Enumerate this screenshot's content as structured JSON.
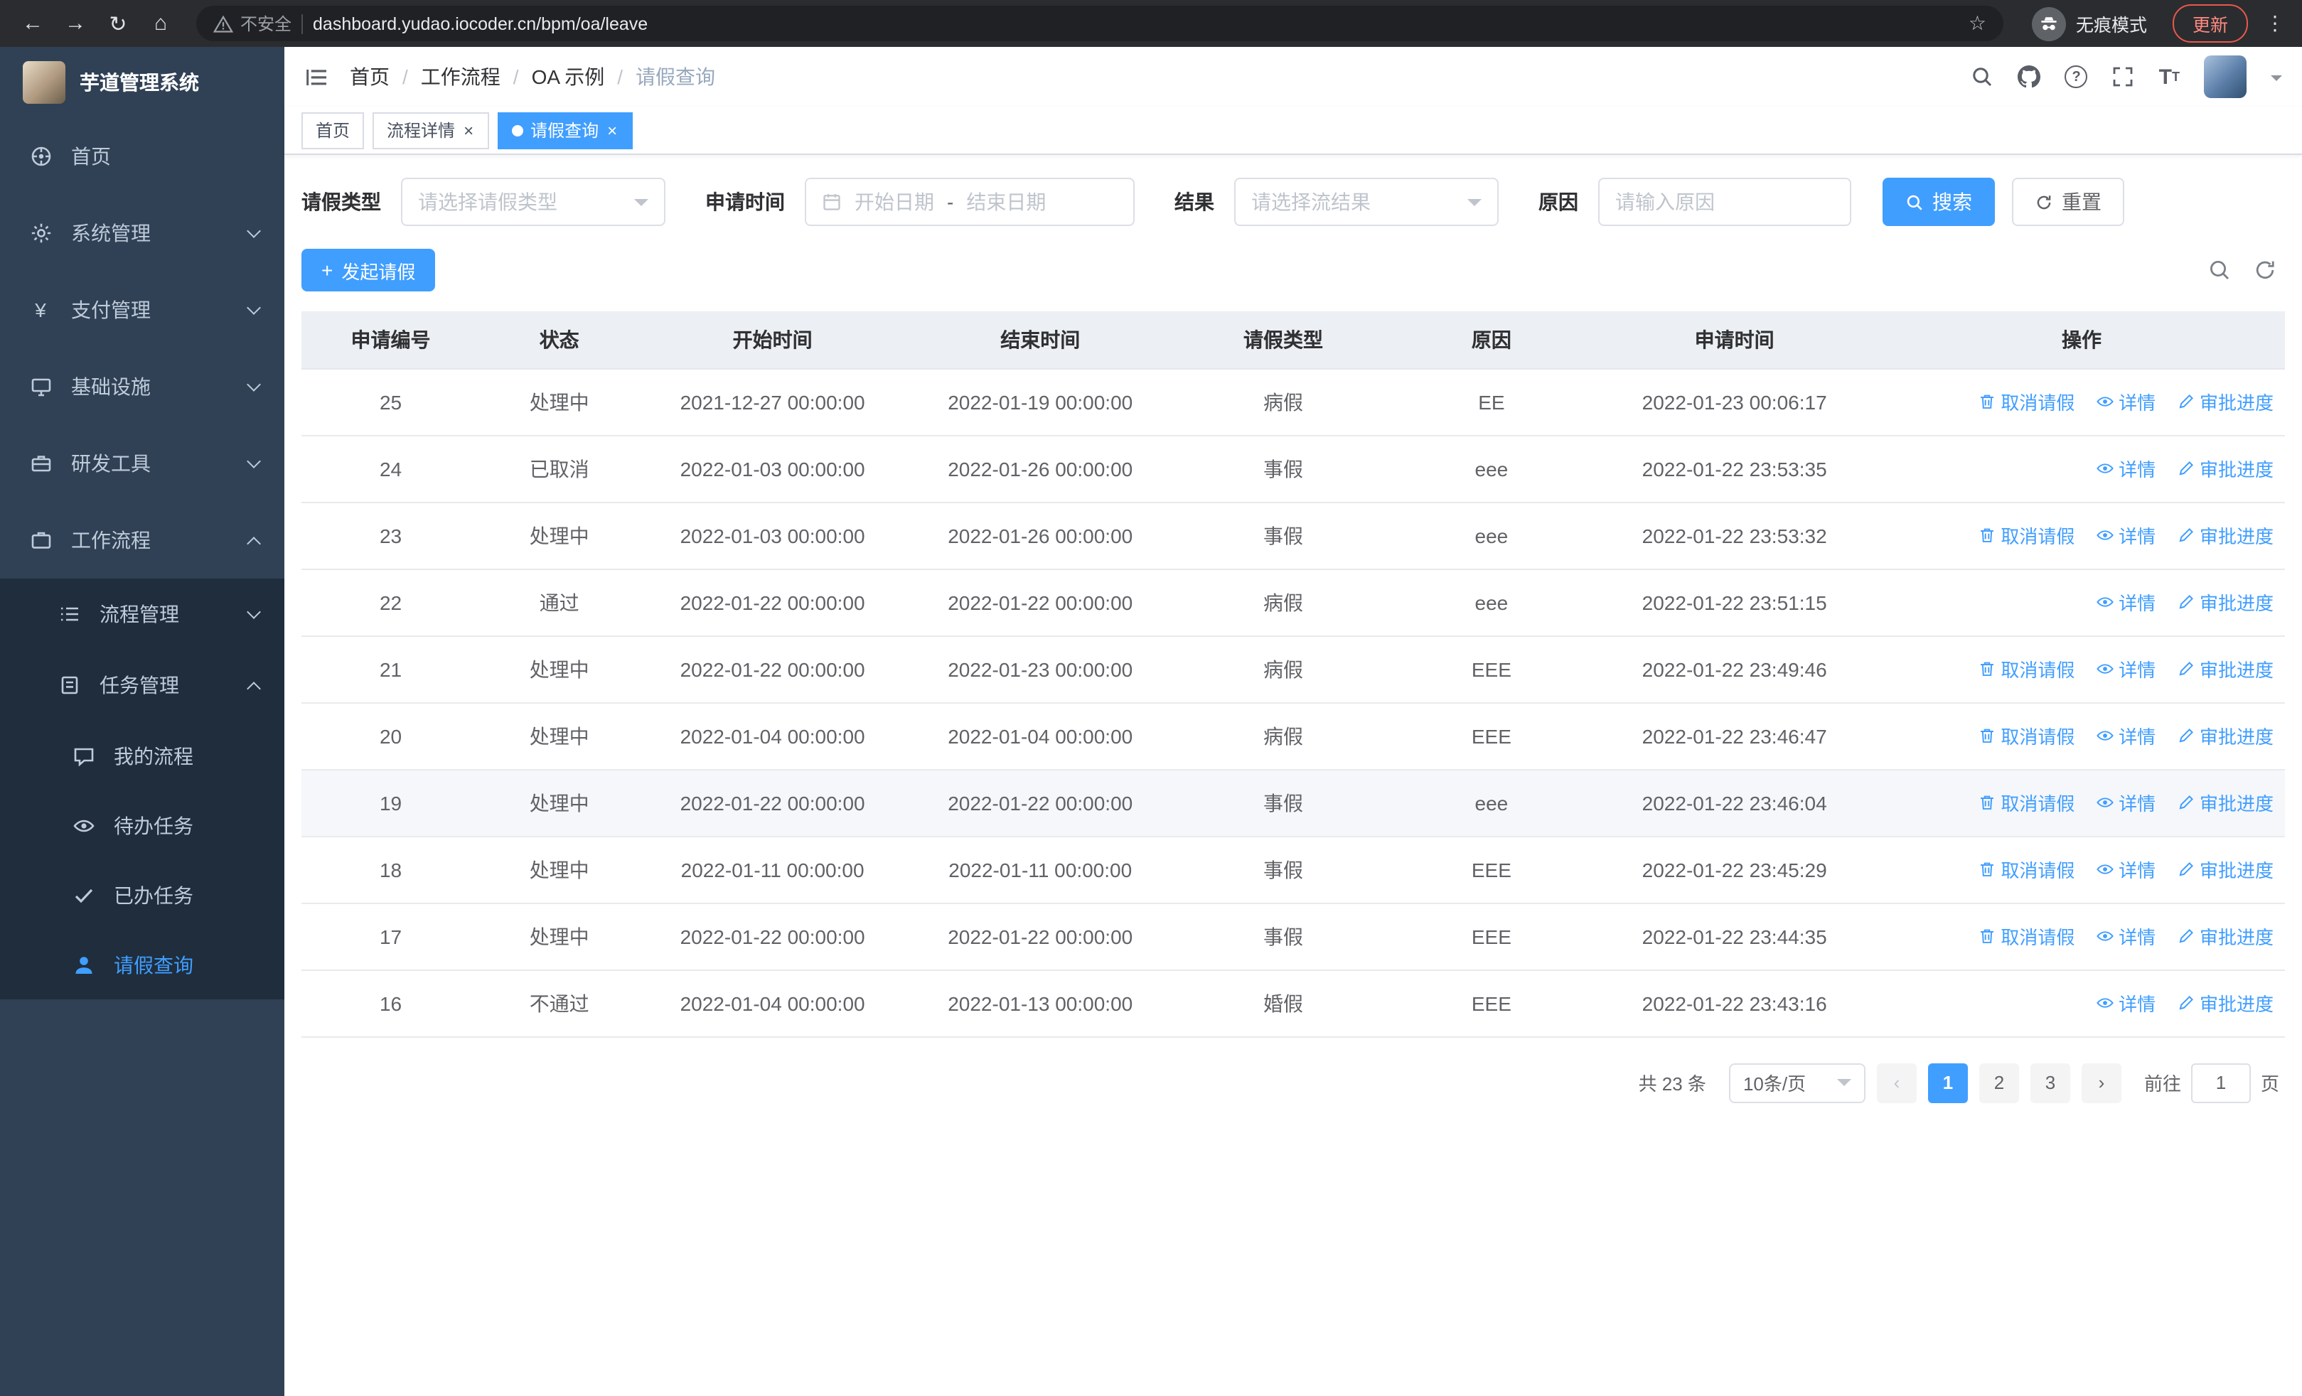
{
  "browser": {
    "back_icon": "←",
    "forward_icon": "→",
    "reload_icon": "↻",
    "home_icon": "⌂",
    "security_label": "不安全",
    "url": "dashboard.yudao.iocoder.cn/bpm/oa/leave",
    "star_icon": "☆",
    "incognito_label": "无痕模式",
    "update_label": "更新",
    "kebab_icon": "⋮"
  },
  "app_title": "芋道管理系统",
  "sidebar": {
    "yen_icon": "¥",
    "menu": [
      {
        "label": "首页"
      },
      {
        "label": "系统管理"
      },
      {
        "label": "支付管理"
      },
      {
        "label": "基础设施"
      },
      {
        "label": "研发工具"
      },
      {
        "label": "工作流程"
      }
    ],
    "submenu": [
      {
        "label": "流程管理"
      },
      {
        "label": "任务管理"
      }
    ],
    "leaves": [
      {
        "label": "我的流程"
      },
      {
        "label": "待办任务"
      },
      {
        "label": "已办任务"
      },
      {
        "label": "请假查询"
      }
    ]
  },
  "breadcrumb": {
    "separator": "/",
    "items": [
      "首页",
      "工作流程",
      "OA 示例",
      "请假查询"
    ]
  },
  "tabs": {
    "close_icon": "×",
    "items": [
      {
        "label": "首页"
      },
      {
        "label": "流程详情"
      },
      {
        "label": "请假查询"
      }
    ]
  },
  "filter": {
    "leave_type_label": "请假类型",
    "leave_type_placeholder": "请选择请假类型",
    "apply_time_label": "申请时间",
    "date_start_placeholder": "开始日期",
    "date_separator": "-",
    "date_end_placeholder": "结束日期",
    "result_label": "结果",
    "result_placeholder": "请选择流结果",
    "reason_label": "原因",
    "reason_placeholder": "请输入原因",
    "search_label": "搜索",
    "reset_label": "重置"
  },
  "toolbar": {
    "plus_icon": "+",
    "create_label": "发起请假"
  },
  "table": {
    "headers": [
      "申请编号",
      "状态",
      "开始时间",
      "结束时间",
      "请假类型",
      "原因",
      "申请时间",
      "操作"
    ],
    "op_labels": {
      "cancel": "取消请假",
      "detail": "详情",
      "progress": "审批进度"
    },
    "rows": [
      {
        "id": "25",
        "status": "处理中",
        "start": "2021-12-27 00:00:00",
        "end": "2022-01-19 00:00:00",
        "type": "病假",
        "reason": "EE",
        "apply_time": "2022-01-23 00:06:17",
        "ops": [
          "cancel",
          "detail",
          "progress"
        ]
      },
      {
        "id": "24",
        "status": "已取消",
        "start": "2022-01-03 00:00:00",
        "end": "2022-01-26 00:00:00",
        "type": "事假",
        "reason": "eee",
        "apply_time": "2022-01-22 23:53:35",
        "ops": [
          "detail",
          "progress"
        ]
      },
      {
        "id": "23",
        "status": "处理中",
        "start": "2022-01-03 00:00:00",
        "end": "2022-01-26 00:00:00",
        "type": "事假",
        "reason": "eee",
        "apply_time": "2022-01-22 23:53:32",
        "ops": [
          "cancel",
          "detail",
          "progress"
        ]
      },
      {
        "id": "22",
        "status": "通过",
        "start": "2022-01-22 00:00:00",
        "end": "2022-01-22 00:00:00",
        "type": "病假",
        "reason": "eee",
        "apply_time": "2022-01-22 23:51:15",
        "ops": [
          "detail",
          "progress"
        ]
      },
      {
        "id": "21",
        "status": "处理中",
        "start": "2022-01-22 00:00:00",
        "end": "2022-01-23 00:00:00",
        "type": "病假",
        "reason": "EEE",
        "apply_time": "2022-01-22 23:49:46",
        "ops": [
          "cancel",
          "detail",
          "progress"
        ]
      },
      {
        "id": "20",
        "status": "处理中",
        "start": "2022-01-04 00:00:00",
        "end": "2022-01-04 00:00:00",
        "type": "病假",
        "reason": "EEE",
        "apply_time": "2022-01-22 23:46:47",
        "ops": [
          "cancel",
          "detail",
          "progress"
        ]
      },
      {
        "id": "19",
        "status": "处理中",
        "start": "2022-01-22 00:00:00",
        "end": "2022-01-22 00:00:00",
        "type": "事假",
        "reason": "eee",
        "apply_time": "2022-01-22 23:46:04",
        "ops": [
          "cancel",
          "detail",
          "progress"
        ],
        "highlighted": true
      },
      {
        "id": "18",
        "status": "处理中",
        "start": "2022-01-11 00:00:00",
        "end": "2022-01-11 00:00:00",
        "type": "事假",
        "reason": "EEE",
        "apply_time": "2022-01-22 23:45:29",
        "ops": [
          "cancel",
          "detail",
          "progress"
        ]
      },
      {
        "id": "17",
        "status": "处理中",
        "start": "2022-01-22 00:00:00",
        "end": "2022-01-22 00:00:00",
        "type": "事假",
        "reason": "EEE",
        "apply_time": "2022-01-22 23:44:35",
        "ops": [
          "cancel",
          "detail",
          "progress"
        ]
      },
      {
        "id": "16",
        "status": "不通过",
        "start": "2022-01-04 00:00:00",
        "end": "2022-01-13 00:00:00",
        "type": "婚假",
        "reason": "EEE",
        "apply_time": "2022-01-22 23:43:16",
        "ops": [
          "detail",
          "progress"
        ]
      }
    ]
  },
  "pagination": {
    "total_text": "共 23 条",
    "page_size": "10条/页",
    "prev_icon": "‹",
    "next_icon": "›",
    "pages": [
      "1",
      "2",
      "3"
    ],
    "goto_label": "前往",
    "goto_value": "1",
    "goto_suffix": "页"
  },
  "colors": {
    "primary": "#409eff",
    "sidebar_bg": "#304156",
    "submenu_bg": "#1f2d3d"
  }
}
